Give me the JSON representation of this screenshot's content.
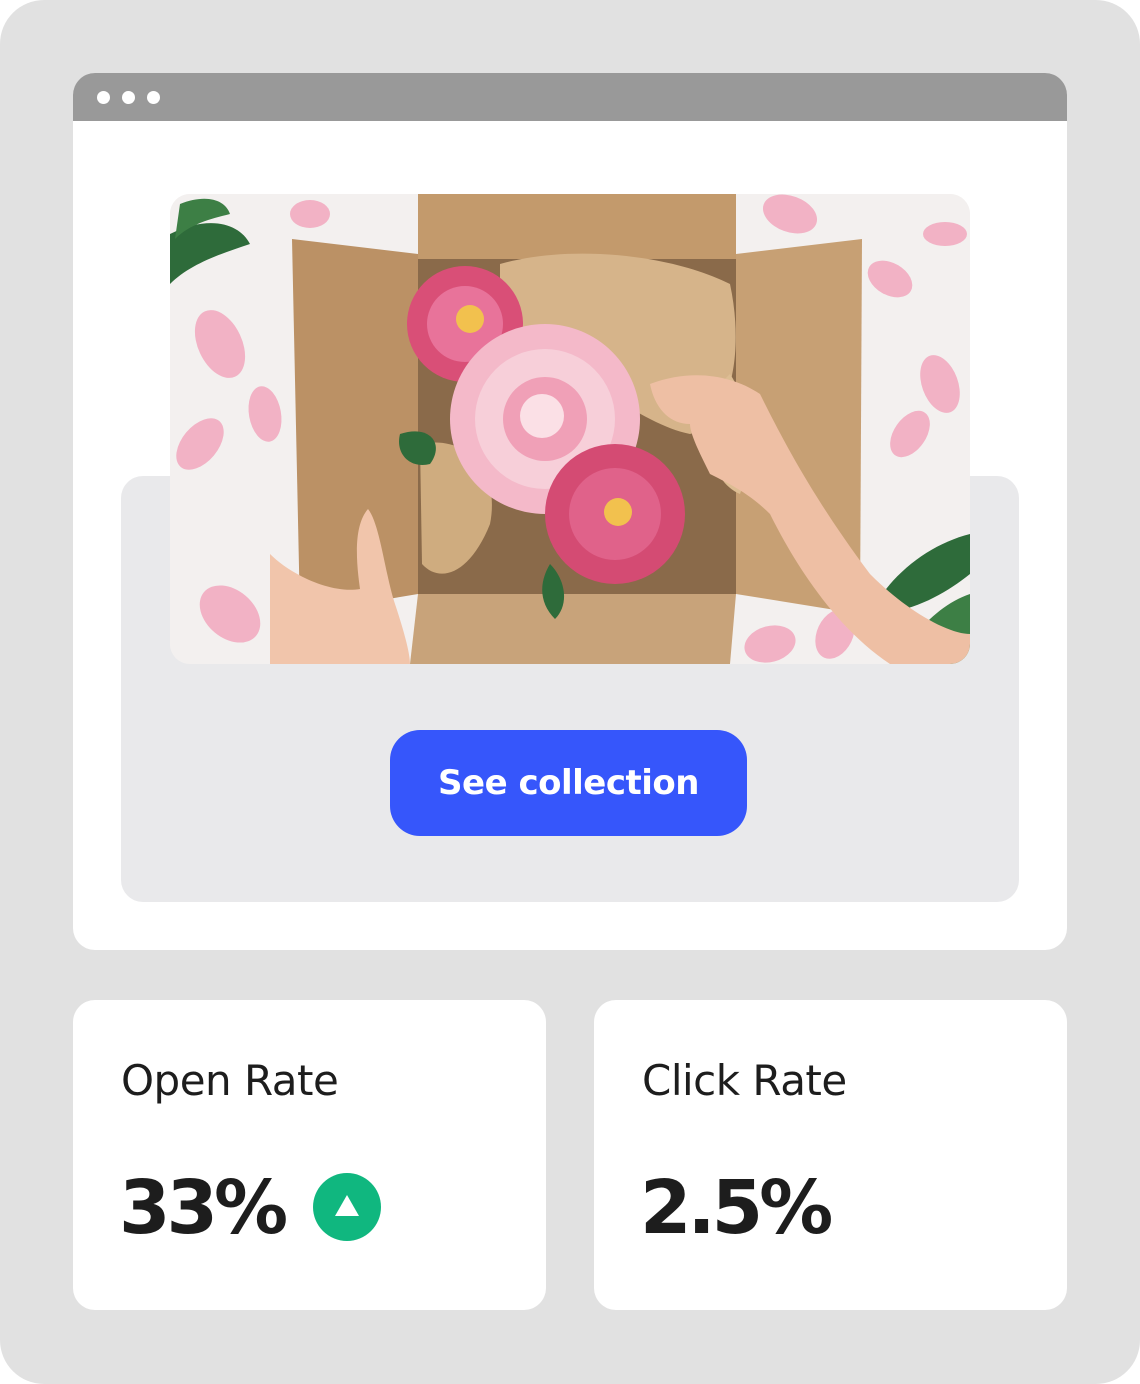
{
  "window": {
    "controls": [
      "dot",
      "dot",
      "dot"
    ]
  },
  "email": {
    "hero_image": "flowers-in-cardboard-box-photo",
    "cta_label": "See collection",
    "cta_color": "#3656fb"
  },
  "stats": {
    "open_rate": {
      "label": "Open Rate",
      "value": "33%",
      "trend": "up",
      "trend_icon": "arrow-up-icon",
      "trend_color": "#10b77f"
    },
    "click_rate": {
      "label": "Click Rate",
      "value": "2.5%"
    }
  }
}
